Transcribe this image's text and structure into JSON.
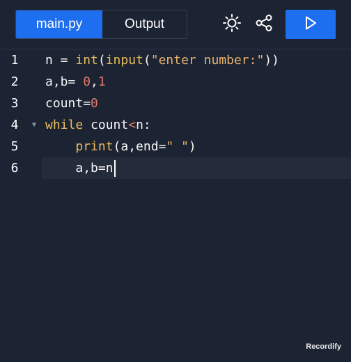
{
  "tabs": {
    "file": "main.py",
    "output": "Output"
  },
  "toolbar": {
    "theme_icon": "sun-icon",
    "share_icon": "share-icon",
    "run_icon": "play-icon"
  },
  "editor": {
    "lines": [
      {
        "num": "1",
        "tokens": [
          "n",
          " = ",
          "int",
          "(",
          "input",
          "(",
          "\"enter number:\"",
          "))"
        ]
      },
      {
        "num": "2",
        "tokens": [
          "a,b",
          "= ",
          "0",
          ",",
          "1"
        ]
      },
      {
        "num": "3",
        "tokens": [
          "count",
          "=",
          "0"
        ]
      },
      {
        "num": "4",
        "tokens": [
          "while",
          " count",
          "<",
          "n:"
        ]
      },
      {
        "num": "5",
        "tokens": [
          "    ",
          "print",
          "(a,end=",
          "\" \"",
          ")"
        ]
      },
      {
        "num": "6",
        "tokens": [
          "    ",
          "a,b",
          "=",
          "n"
        ]
      }
    ]
  },
  "watermark": "Recordify",
  "colors": {
    "background": "#1c2333",
    "accent": "#1e6ff0",
    "keyword": "#e9bd5a",
    "number": "#e07a6a"
  }
}
